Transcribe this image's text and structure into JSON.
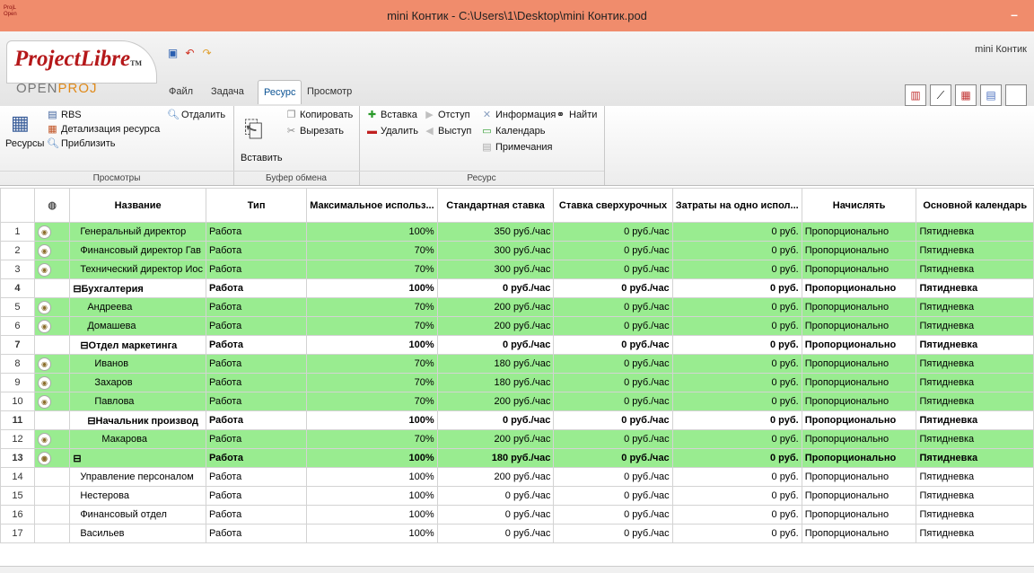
{
  "window": {
    "title": "mini Контик - C:\\Users\\1\\Desktop\\mini Контик.pod",
    "minimize": "–",
    "app_icon_text": "ProjL Open"
  },
  "logo": {
    "main": "ProjectLibre",
    "tm": "TM",
    "sub1": "OPEN",
    "sub2": "PROJ",
    "sub3": ""
  },
  "quick_access": [
    {
      "icon": "save-icon",
      "glyph": "▣"
    },
    {
      "icon": "undo-icon",
      "glyph": "↶"
    },
    {
      "icon": "redo-icon",
      "glyph": "↷"
    }
  ],
  "tabs": {
    "file": "Файл",
    "task": "Задача",
    "resource": "Ресурс",
    "view": "Просмотр",
    "project_tab": "mini Контик"
  },
  "ribbon": {
    "views": {
      "caption": "Просмотры",
      "resources": "Ресурсы",
      "rbs": "RBS",
      "detail": "Детализация ресурса",
      "zoom_in": "Приблизить",
      "zoom_out": "Отдалить"
    },
    "clipboard": {
      "caption": "Буфер обмена",
      "paste": "Вставить",
      "copy": "Копировать",
      "cut": "Вырезать"
    },
    "resource": {
      "caption": "Ресурс",
      "insert": "Вставка",
      "delete": "Удалить",
      "indent": "Отступ",
      "outdent": "Выступ",
      "info": "Информация",
      "calendar": "Календарь",
      "notes": "Примечания",
      "find": "Найти"
    }
  },
  "table": {
    "headers": [
      "",
      "",
      "Название",
      "Тип",
      "Максимальное использ...",
      "Стандартная ставка",
      "Ставка сверхурочных",
      "Затраты на одно испол...",
      "Начислять",
      "Основной календарь"
    ],
    "rows": [
      {
        "n": "1",
        "icon": true,
        "name": "Генеральный директор",
        "indent": 1,
        "type": "Работа",
        "max": "100%",
        "std": "350 руб./час",
        "ot": "0 руб./час",
        "cost": "0 руб.",
        "accrue": "Пропорционально",
        "cal": "Пятидневка",
        "style": "g"
      },
      {
        "n": "2",
        "icon": true,
        "name": "Финансовый директор Гав",
        "indent": 1,
        "type": "Работа",
        "max": "70%",
        "std": "300 руб./час",
        "ot": "0 руб./час",
        "cost": "0 руб.",
        "accrue": "Пропорционально",
        "cal": "Пятидневка",
        "style": "g"
      },
      {
        "n": "3",
        "icon": true,
        "name": "Технический директор Иос",
        "indent": 1,
        "type": "Работа",
        "max": "70%",
        "std": "300 руб./час",
        "ot": "0 руб./час",
        "cost": "0 руб.",
        "accrue": "Пропорционально",
        "cal": "Пятидневка",
        "style": "g"
      },
      {
        "n": "4",
        "icon": false,
        "name": "⊟Бухгалтерия",
        "indent": 0,
        "type": "Работа",
        "max": "100%",
        "std": "0 руб./час",
        "ot": "0 руб./час",
        "cost": "0 руб.",
        "accrue": "Пропорционально",
        "cal": "Пятидневка",
        "style": "b"
      },
      {
        "n": "5",
        "icon": true,
        "name": "Андреева",
        "indent": 2,
        "type": "Работа",
        "max": "70%",
        "std": "200 руб./час",
        "ot": "0 руб./час",
        "cost": "0 руб.",
        "accrue": "Пропорционально",
        "cal": "Пятидневка",
        "style": "g"
      },
      {
        "n": "6",
        "icon": true,
        "name": "Домашева",
        "indent": 2,
        "type": "Работа",
        "max": "70%",
        "std": "200 руб./час",
        "ot": "0 руб./час",
        "cost": "0 руб.",
        "accrue": "Пропорционально",
        "cal": "Пятидневка",
        "style": "g"
      },
      {
        "n": "7",
        "icon": false,
        "name": "⊟Отдел маркетинга",
        "indent": 1,
        "type": "Работа",
        "max": "100%",
        "std": "0 руб./час",
        "ot": "0 руб./час",
        "cost": "0 руб.",
        "accrue": "Пропорционально",
        "cal": "Пятидневка",
        "style": "b"
      },
      {
        "n": "8",
        "icon": true,
        "name": "Иванов",
        "indent": 3,
        "type": "Работа",
        "max": "70%",
        "std": "180 руб./час",
        "ot": "0 руб./час",
        "cost": "0 руб.",
        "accrue": "Пропорционально",
        "cal": "Пятидневка",
        "style": "g"
      },
      {
        "n": "9",
        "icon": true,
        "name": "Захаров",
        "indent": 3,
        "type": "Работа",
        "max": "70%",
        "std": "180 руб./час",
        "ot": "0 руб./час",
        "cost": "0 руб.",
        "accrue": "Пропорционально",
        "cal": "Пятидневка",
        "style": "g"
      },
      {
        "n": "10",
        "icon": true,
        "name": "Павлова",
        "indent": 3,
        "type": "Работа",
        "max": "70%",
        "std": "200 руб./час",
        "ot": "0 руб./час",
        "cost": "0 руб.",
        "accrue": "Пропорционально",
        "cal": "Пятидневка",
        "style": "g"
      },
      {
        "n": "11",
        "icon": false,
        "name": "⊟Начальник производ",
        "indent": 2,
        "type": "Работа",
        "max": "100%",
        "std": "0 руб./час",
        "ot": "0 руб./час",
        "cost": "0 руб.",
        "accrue": "Пропорционально",
        "cal": "Пятидневка",
        "style": "b"
      },
      {
        "n": "12",
        "icon": true,
        "name": "Макарова",
        "indent": 4,
        "type": "Работа",
        "max": "70%",
        "std": "200 руб./час",
        "ot": "0 руб./час",
        "cost": "0 руб.",
        "accrue": "Пропорционально",
        "cal": "Пятидневка",
        "style": "g"
      },
      {
        "n": "13",
        "icon": true,
        "name": "⊟",
        "indent": 0,
        "type": "Работа",
        "max": "100%",
        "std": "180 руб./час",
        "ot": "0 руб./час",
        "cost": "0 руб.",
        "accrue": "Пропорционально",
        "cal": "Пятидневка",
        "style": "g b"
      },
      {
        "n": "14",
        "icon": false,
        "name": "Управление персоналом",
        "indent": 1,
        "type": "Работа",
        "max": "100%",
        "std": "200 руб./час",
        "ot": "0 руб./час",
        "cost": "0 руб.",
        "accrue": "Пропорционально",
        "cal": "Пятидневка",
        "style": ""
      },
      {
        "n": "15",
        "icon": false,
        "name": "Нестерова",
        "indent": 1,
        "type": "Работа",
        "max": "100%",
        "std": "0 руб./час",
        "ot": "0 руб./час",
        "cost": "0 руб.",
        "accrue": "Пропорционально",
        "cal": "Пятидневка",
        "style": ""
      },
      {
        "n": "16",
        "icon": false,
        "name": "Финансовый отдел",
        "indent": 1,
        "type": "Работа",
        "max": "100%",
        "std": "0 руб./час",
        "ot": "0 руб./час",
        "cost": "0 руб.",
        "accrue": "Пропорционально",
        "cal": "Пятидневка",
        "style": ""
      },
      {
        "n": "17",
        "icon": false,
        "name": "Васильев",
        "indent": 1,
        "type": "Работа",
        "max": "100%",
        "std": "0 руб./час",
        "ot": "0 руб./час",
        "cost": "0 руб.",
        "accrue": "Пропорционально",
        "cal": "Пятидневка",
        "style": ""
      }
    ]
  },
  "colors": {
    "titlebar": "#f08c6c",
    "row_green": "#99ec90",
    "logo_red": "#b5181a"
  }
}
